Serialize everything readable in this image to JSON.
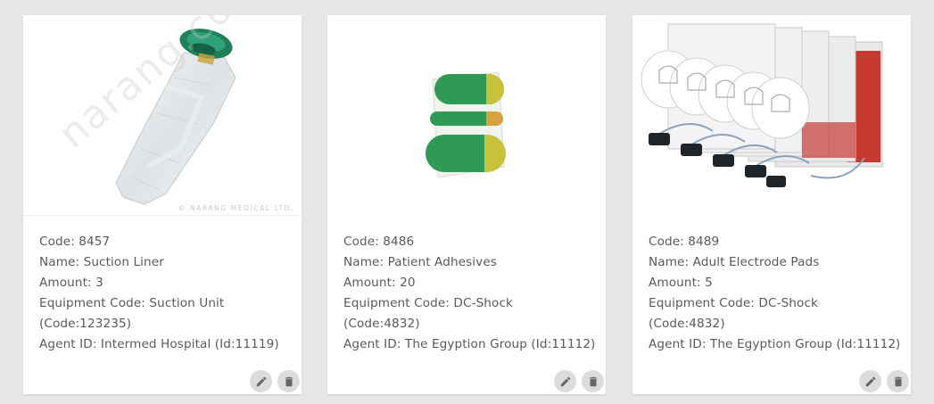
{
  "cards": [
    {
      "code": "Code: 8457",
      "name": "Name: Suction Liner",
      "amount": "Amount: 3",
      "equipment_line1": "Equipment Code: Suction Unit",
      "equipment_line2": "(Code:123235)",
      "agent": "Agent ID: Intermed Hospital (Id:11119)",
      "image_watermark": "© NARANG MEDICAL LTD.",
      "image_diag_watermark": "narang.com",
      "image_icon": "suction-liner-image"
    },
    {
      "code": "Code: 8486",
      "name": "Name: Patient Adhesives",
      "amount": "Amount: 20",
      "equipment_line1": "Equipment Code: DC-Shock",
      "equipment_line2": "(Code:4832)",
      "agent": "Agent ID: The Egyption Group (Id:11112)",
      "image_icon": "patient-adhesives-image"
    },
    {
      "code": "Code: 8489",
      "name": "Name: Adult Electrode Pads",
      "amount": "Amount: 5",
      "equipment_line1": "Equipment Code: DC-Shock",
      "equipment_line2": "(Code:4832)",
      "agent": "Agent ID: The Egyption Group (Id:11112)",
      "image_icon": "electrode-pads-image"
    }
  ],
  "icons": {
    "edit": "pencil-icon",
    "delete": "trash-icon"
  },
  "colors": {
    "background": "#e6e6e6",
    "card": "#ffffff",
    "text": "#5a5a5a",
    "icon_button": "#dcdcdc",
    "icon": "#666666",
    "adhesive_green": "#2f9a55",
    "adhesive_yellow": "#c8c23a"
  }
}
